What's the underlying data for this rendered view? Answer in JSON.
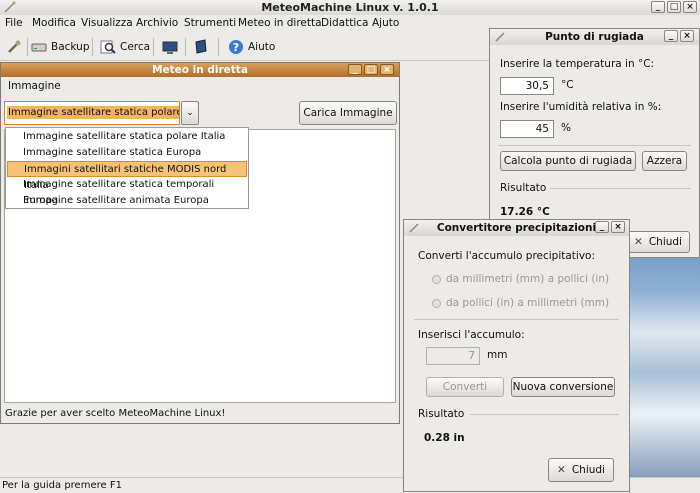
{
  "main": {
    "title": "MeteoMachine Linux v. 1.0.1",
    "menu": [
      "File",
      "Modifica",
      "Visualizza",
      "Archivio",
      "Strumenti",
      "Meteo in diretta",
      "Didattica",
      "Ajuto"
    ],
    "toolbar": {
      "backup": "Backup",
      "cerca": "Cerca",
      "aiuto": "Aiuto"
    },
    "status": "Per la guida premere F1"
  },
  "meteo": {
    "title": "Meteo in diretta",
    "menu": "Immagine",
    "combo_value": "Immagine satellitare statica polare Italia",
    "load_button": "Carica Immagine",
    "options": [
      "Immagine satellitare statica polare Italia",
      "Immagine satellitare statica Europa",
      "Immagini satellitari statiche MODIS nord Italia",
      "Immagine satellitare statica temporali Europa",
      "Immagine satellitare animata Europa"
    ],
    "selected_index": 2,
    "status": "Grazie per aver scelto MeteoMachine Linux!"
  },
  "rugiada": {
    "title": "Punto di rugiada",
    "temp_label": "Inserire la temperatura in °C:",
    "temp_value": "30,5",
    "temp_unit": "°C",
    "hum_label": "Inserire l'umidità relativa in %:",
    "hum_value": "45",
    "hum_unit": "%",
    "calc_button": "Calcola punto di rugiada",
    "reset_button": "Azzera",
    "result_label": "Risultato",
    "result_value": "17.26 °C",
    "close_button": "Chiudi"
  },
  "conv": {
    "title": "Convertitore precipitazioni",
    "prompt": "Converti l'accumulo precipitativo:",
    "option1": "da millimetri (mm) a pollici (in)",
    "option2": "da pollici (in) a millimetri (mm)",
    "input_label": "Inserisci l'accumulo:",
    "input_placeholder": "7",
    "input_unit": "mm",
    "convert_button": "Converti",
    "new_button": "Nuova conversione",
    "result_label": "Risultato",
    "result_value": "0.28 in",
    "close_button": "Chiudi"
  }
}
